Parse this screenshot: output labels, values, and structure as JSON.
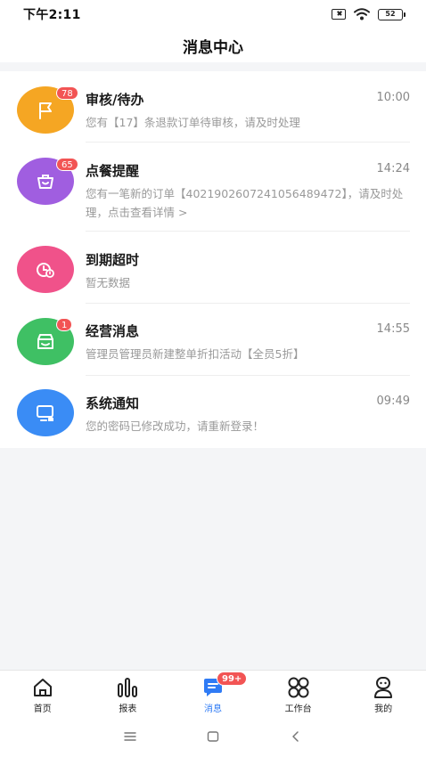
{
  "status_bar": {
    "time": "下午2:11",
    "battery": "52"
  },
  "header": {
    "title": "消息中心"
  },
  "messages": [
    {
      "icon": "flag-icon",
      "color": "#f5a623",
      "badge": "78",
      "title": "审核/待办",
      "time": "10:00",
      "desc": "您有【17】条退款订单待审核，请及时处理"
    },
    {
      "icon": "dining-icon",
      "color": "#a05ee0",
      "badge": "65",
      "title": "点餐提醒",
      "time": "14:24",
      "desc": "您有一笔新的订单【4021902607241056489472】，请及时处理，点击查看详情 >"
    },
    {
      "icon": "clock-icon",
      "color": "#f0528a",
      "badge": "",
      "title": "到期超时",
      "time": "",
      "desc": "暂无数据"
    },
    {
      "icon": "store-icon",
      "color": "#3fc064",
      "badge": "1",
      "title": "经营消息",
      "time": "14:55",
      "desc": "管理员管理员新建整单折扣活动【全员5折】"
    },
    {
      "icon": "monitor-bell-icon",
      "color": "#3a8cf5",
      "badge": "",
      "title": "系统通知",
      "time": "09:49",
      "desc": "您的密码已修改成功，请重新登录！"
    }
  ],
  "tabs": [
    {
      "label": "首页",
      "icon": "home-icon",
      "active": false
    },
    {
      "label": "报表",
      "icon": "bar-chart-icon",
      "active": false
    },
    {
      "label": "消息",
      "icon": "message-icon",
      "active": true,
      "badge": "99+"
    },
    {
      "label": "工作台",
      "icon": "grid-icon",
      "active": false
    },
    {
      "label": "我的",
      "icon": "profile-icon",
      "active": false
    }
  ],
  "colors": {
    "accent": "#2f7bf5",
    "badge": "#f25454"
  }
}
